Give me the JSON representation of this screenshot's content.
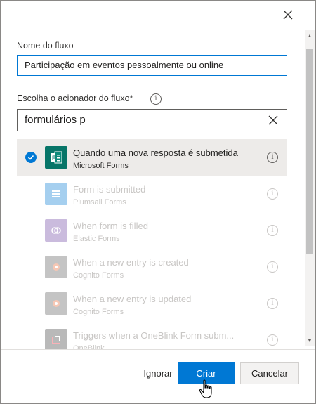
{
  "dialog": {
    "flow_name_label": "Nome do fluxo",
    "flow_name_value": "Participação em eventos pessoalmente ou online",
    "trigger_label": "Escolha o acionador do fluxo*",
    "search_value": "formulários p"
  },
  "triggers": [
    {
      "title": "Quando uma nova resposta é submetida",
      "connector": "Microsoft Forms",
      "icon": "microsoft-forms-icon",
      "color": "#077568",
      "selected": true,
      "enabled": true
    },
    {
      "title": "Form is submitted",
      "connector": "Plumsail Forms",
      "icon": "plumsail-forms-icon",
      "color": "#0078d4",
      "selected": false,
      "enabled": false
    },
    {
      "title": "When form is filled",
      "connector": "Elastic Forms",
      "icon": "elastic-forms-icon",
      "color": "#6b3fa0",
      "selected": false,
      "enabled": false
    },
    {
      "title": "When a new entry is created",
      "connector": "Cognito Forms",
      "icon": "cognito-forms-icon",
      "color": "#5a5a5a",
      "selected": false,
      "enabled": false
    },
    {
      "title": "When a new entry is updated",
      "connector": "Cognito Forms",
      "icon": "cognito-forms-icon",
      "color": "#5a5a5a",
      "selected": false,
      "enabled": false
    },
    {
      "title": "Triggers when a OneBlink Form subm...",
      "connector": "OneBlink",
      "icon": "oneblink-icon",
      "color": "#3a3a3a",
      "selected": false,
      "enabled": false
    }
  ],
  "footer": {
    "ignore_label": "Ignorar",
    "create_label": "Criar",
    "cancel_label": "Cancelar"
  },
  "colors": {
    "accent": "#0078d4",
    "selected_row": "#edebe9"
  }
}
